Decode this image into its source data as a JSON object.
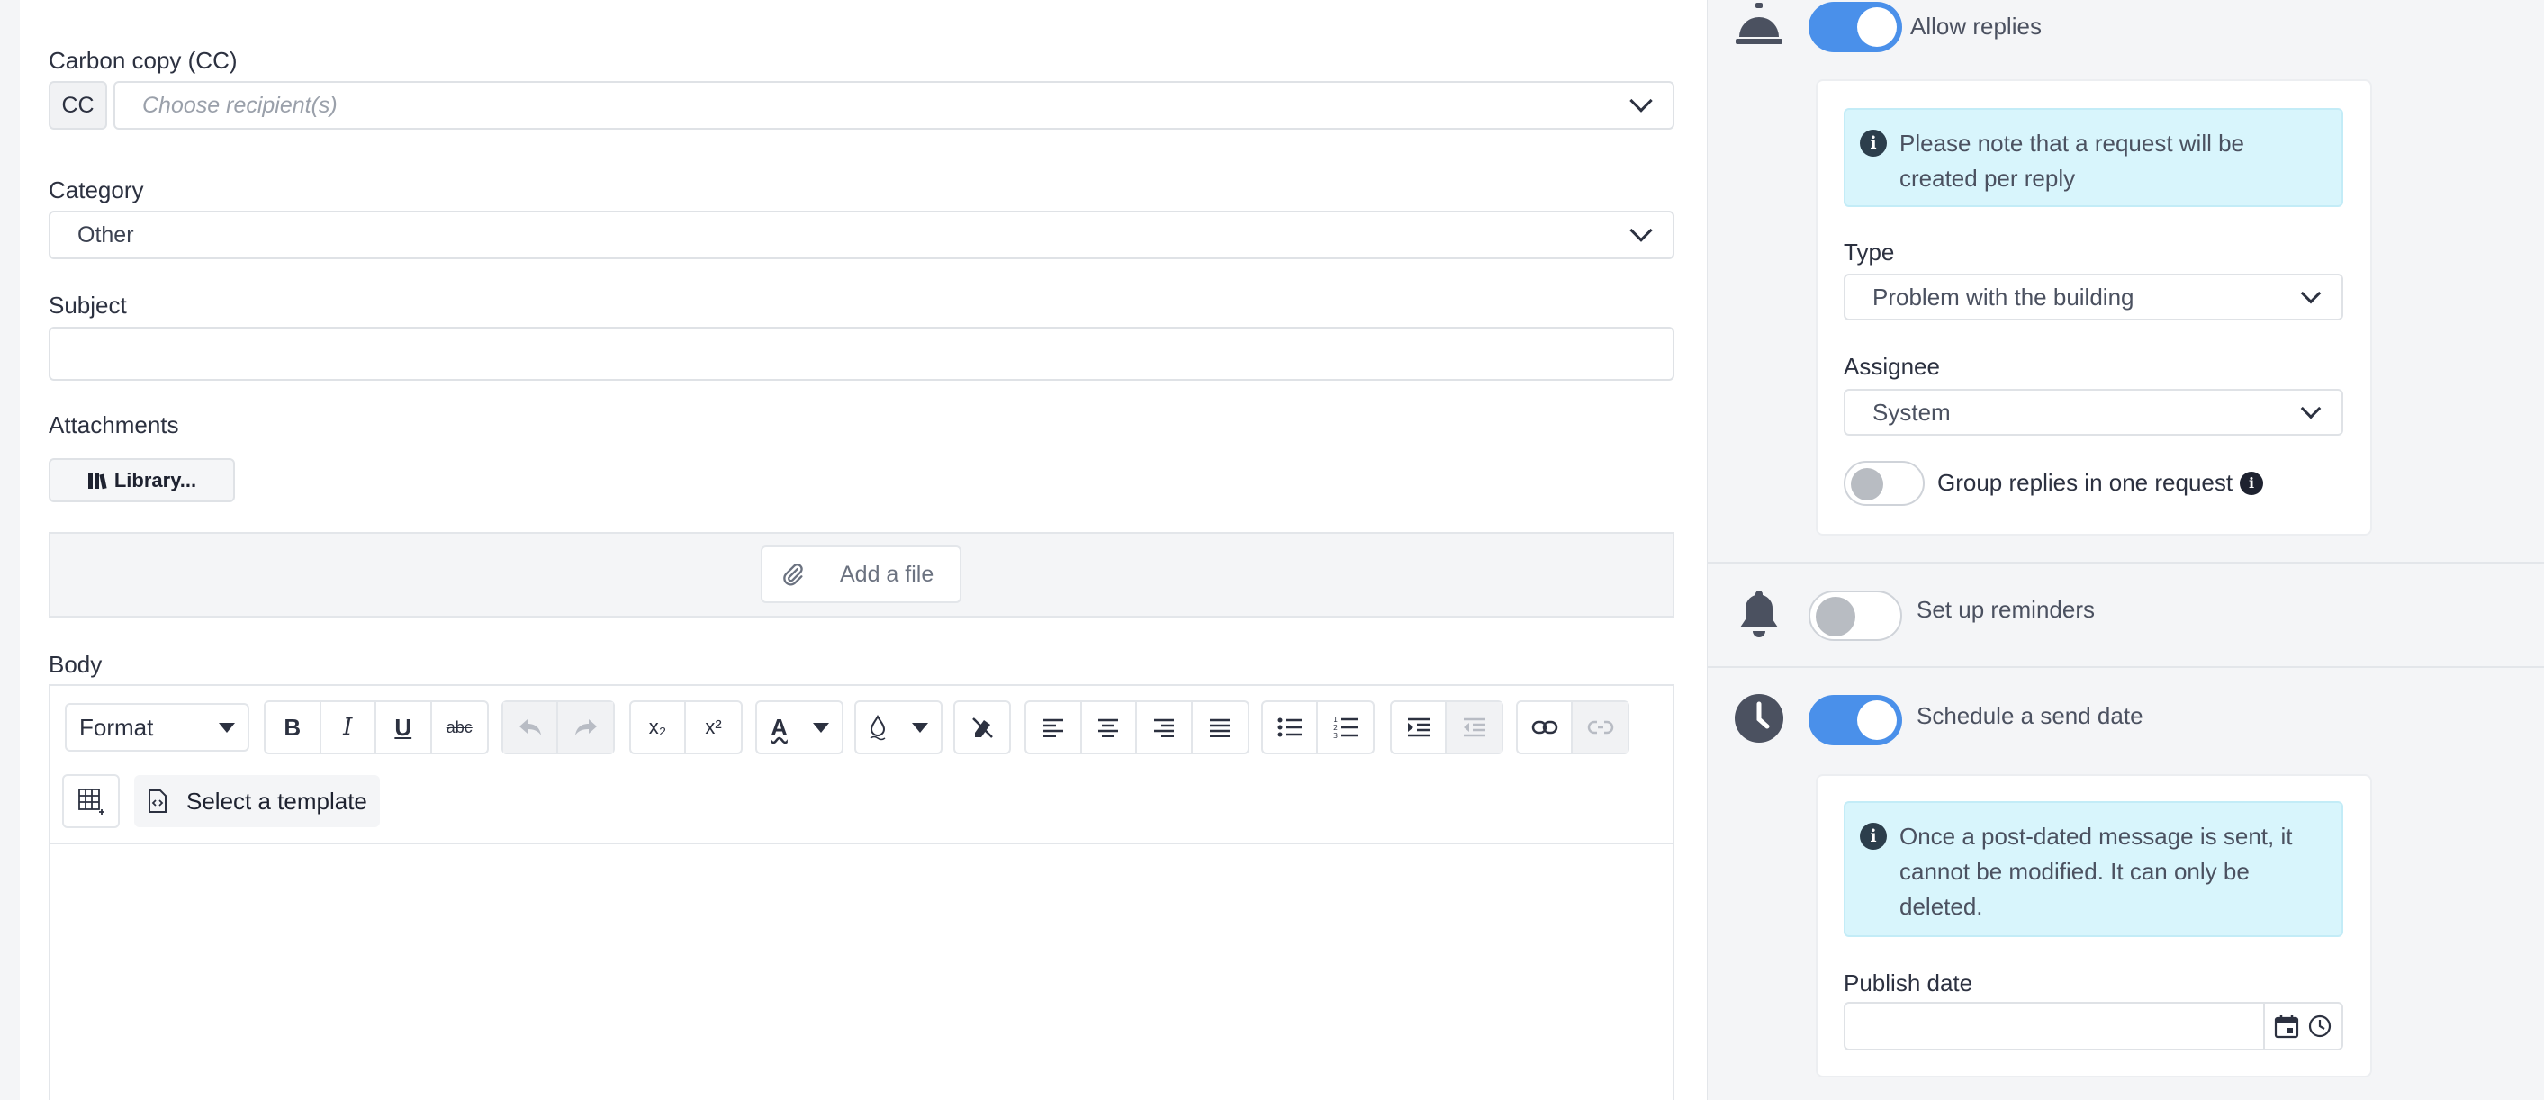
{
  "form": {
    "cc": {
      "label": "Carbon copy (CC)",
      "badge": "CC",
      "placeholder": "Choose recipient(s)"
    },
    "category": {
      "label": "Category",
      "value": "Other"
    },
    "subject": {
      "label": "Subject",
      "value": ""
    },
    "attachments": {
      "label": "Attachments",
      "library_button": "Library...",
      "add_file_button": "Add a file"
    },
    "body": {
      "label": "Body",
      "format_select": "Format",
      "template_button": "Select a template"
    }
  },
  "sidebar": {
    "allow_replies": {
      "label": "Allow replies",
      "enabled": true,
      "info": "Please note that a request will be created per reply",
      "type": {
        "label": "Type",
        "value": "Problem with the building"
      },
      "assignee": {
        "label": "Assignee",
        "value": "System"
      },
      "group_replies": {
        "label": "Group replies in one request",
        "enabled": false
      }
    },
    "reminders": {
      "label": "Set up reminders",
      "enabled": false
    },
    "schedule": {
      "label": "Schedule a send date",
      "enabled": true,
      "info": "Once a post-dated message is sent, it cannot be modified. It can only be deleted.",
      "publish_date": {
        "label": "Publish date",
        "value": ""
      }
    }
  },
  "colors": {
    "accent": "#4a90ea",
    "info_bg": "#d8f5fc",
    "icon_dark": "#2c3e4c"
  }
}
